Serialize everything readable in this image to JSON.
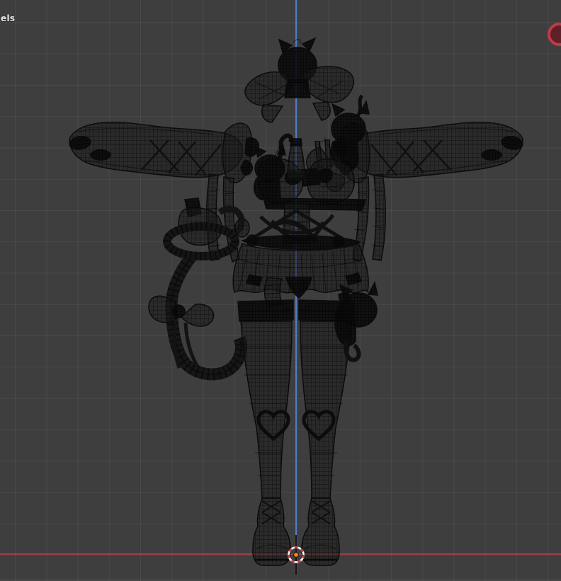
{
  "viewport": {
    "editor": "3d-wireframe-viewport",
    "overlay_label": "els",
    "background_color": "#3e3e3e",
    "grid_color": "#4a4a4a",
    "x_axis_color": "#9e4049",
    "z_axis_color": "#507cc8",
    "cursor": {
      "ring_red": "#d04040",
      "ring_white": "#f2f2f2",
      "dot_color": "#ef8f0e"
    },
    "record_indicator_color": "#c13a45"
  },
  "scene": {
    "description": "Disassembled wireframe pieces of a cat-themed character outfit arranged around the vertical axis",
    "parts": [
      {
        "name": "hair-bow-with-cat-head"
      },
      {
        "name": "left-arm-sleeve-with-ribbons"
      },
      {
        "name": "right-arm-sleeve-with-ribbons"
      },
      {
        "name": "cat-figure-on-right-sleeve"
      },
      {
        "name": "bra-top-with-center-bow"
      },
      {
        "name": "cat-figure-on-bra"
      },
      {
        "name": "bottle"
      },
      {
        "name": "waist-harness-with-straps"
      },
      {
        "name": "ruffled-skirt"
      },
      {
        "name": "panties"
      },
      {
        "name": "curved-tail-staff-with-bow"
      },
      {
        "name": "left-thigh-high-stocking-and-boot"
      },
      {
        "name": "right-thigh-high-stocking-and-boot"
      },
      {
        "name": "cat-figure-on-right-stocking"
      }
    ]
  }
}
